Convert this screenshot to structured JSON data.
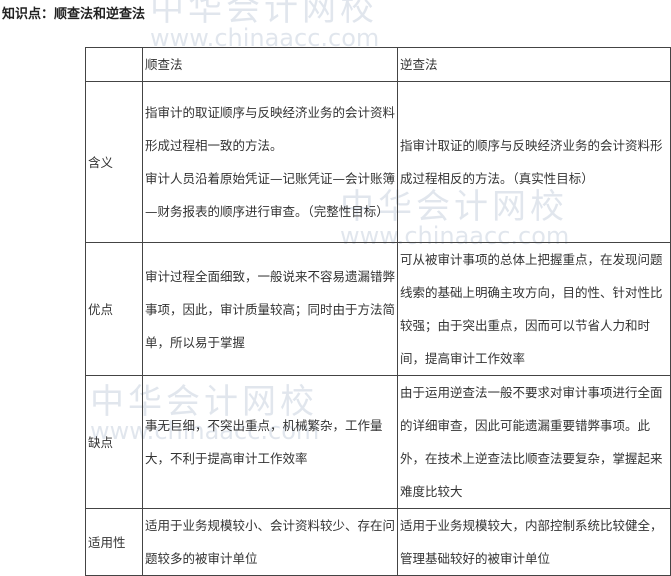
{
  "title": "知识点：顺查法和逆查法",
  "watermark": {
    "cn": "中华会计网校",
    "en": "www.chinaacc.com"
  },
  "table": {
    "headers": [
      "",
      "顺查法",
      "逆查法"
    ],
    "rows": [
      {
        "label": "含义",
        "shun": "指审计的取证顺序与反映经济业务的会计资料形成过程相一致的方法。\n审计人员沿着原始凭证—记账凭证—会计账簿—财务报表的顺序进行审查。（完整性目标）",
        "ni": "指审计取证的顺序与反映经济业务的会计资料形成过程相反的方法。（真实性目标）"
      },
      {
        "label": "优点",
        "shun": "审计过程全面细致，一般说来不容易遗漏错弊事项，因此，审计质量较高；同时由于方法简单，所以易于掌握",
        "ni": "可从被审计事项的总体上把握重点，在发现问题线索的基础上明确主攻方向，目的性、针对性比较强；由于突出重点，因而可以节省人力和时间，提高审计工作效率"
      },
      {
        "label": "缺点",
        "shun": "事无巨细，不突出重点，机械繁杂，工作量大，不利于提高审计工作效率",
        "ni": "由于运用逆查法一般不要求对审计事项进行全面的详细审查，因此可能遗漏重要错弊事项。此外，在技术上逆查法比顺查法要复杂，掌握起来难度比较大"
      },
      {
        "label": "适用性",
        "shun": "适用于业务规模较小、会计资料较少、存在问题较多的被审计单位",
        "ni": "适用于业务规模较大，内部控制系统比较健全，管理基础较好的被审计单位"
      }
    ]
  }
}
